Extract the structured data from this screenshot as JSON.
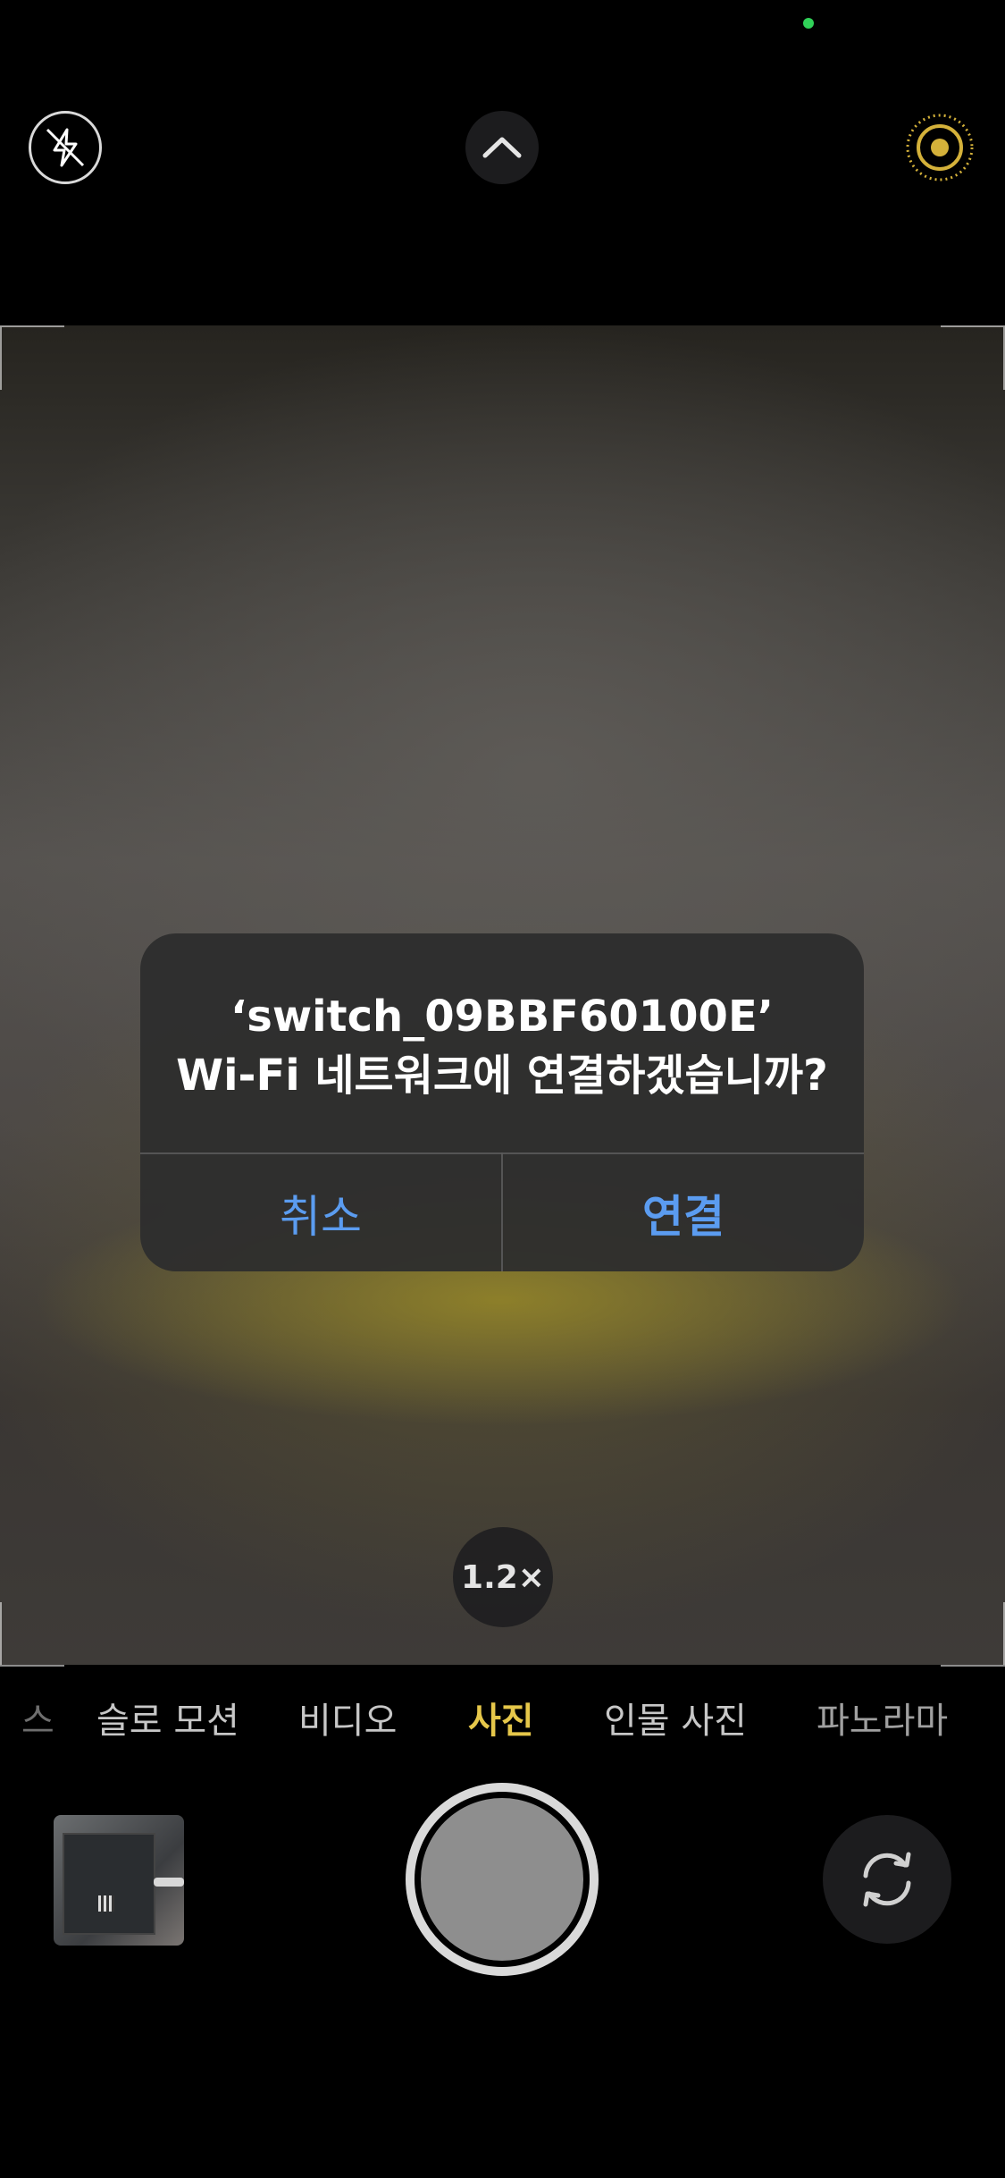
{
  "status": {
    "privacy_indicator_color": "#30d158"
  },
  "top_controls": {
    "flash_icon": "flash-off-icon",
    "controls_icon": "chevron-up-icon",
    "live_photo_icon": "live-photo-icon",
    "live_photo_color": "#d4b13a"
  },
  "viewfinder": {
    "zoom_label": "1.2×"
  },
  "alert": {
    "title_line1": "‘switch_09BBF60100E’",
    "title_line2": "Wi-Fi 네트워크에 연결하겠습니까?",
    "cancel_label": "취소",
    "connect_label": "연결",
    "button_color": "#5b9cf0"
  },
  "modes": {
    "items": [
      {
        "label": "스"
      },
      {
        "label": "슬로 모션"
      },
      {
        "label": "비디오"
      },
      {
        "label": "사진"
      },
      {
        "label": "인물 사진"
      },
      {
        "label": "파노라마"
      }
    ],
    "active": "사진",
    "active_color": "#e6c74a"
  },
  "bottom_controls": {
    "shutter_icon": "shutter-button",
    "flip_icon": "camera-flip-icon"
  }
}
